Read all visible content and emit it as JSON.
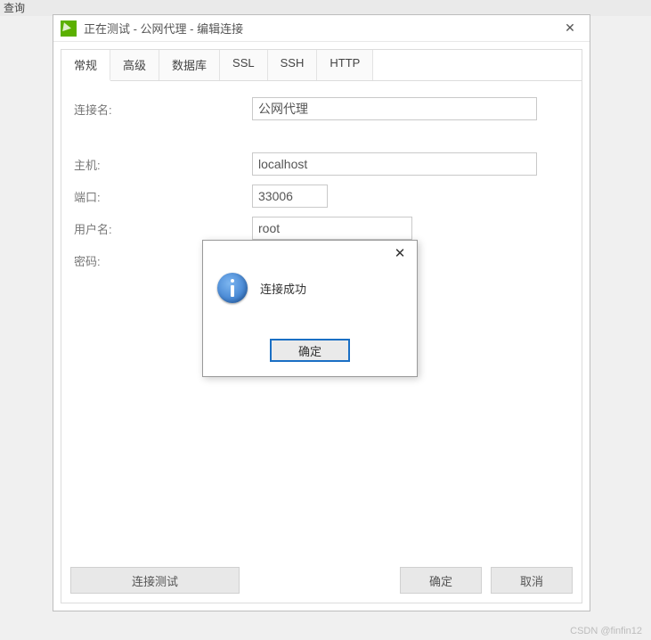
{
  "background": {
    "menu_item": "查询"
  },
  "window": {
    "title": "正在测试 - 公网代理 - 编辑连接"
  },
  "tabs": [
    "常规",
    "高级",
    "数据库",
    "SSL",
    "SSH",
    "HTTP"
  ],
  "active_tab_index": 0,
  "form": {
    "connection_name": {
      "label": "连接名:",
      "value": "公网代理"
    },
    "host": {
      "label": "主机:",
      "value": "localhost"
    },
    "port": {
      "label": "端口:",
      "value": "33006"
    },
    "username": {
      "label": "用户名:",
      "value": "root"
    },
    "password": {
      "label": "密码:",
      "value": "••••••••"
    }
  },
  "buttons": {
    "test_connection": "连接测试",
    "ok": "确定",
    "cancel": "取消"
  },
  "modal": {
    "message": "连接成功",
    "ok": "确定"
  },
  "watermark": "CSDN @finfin12"
}
